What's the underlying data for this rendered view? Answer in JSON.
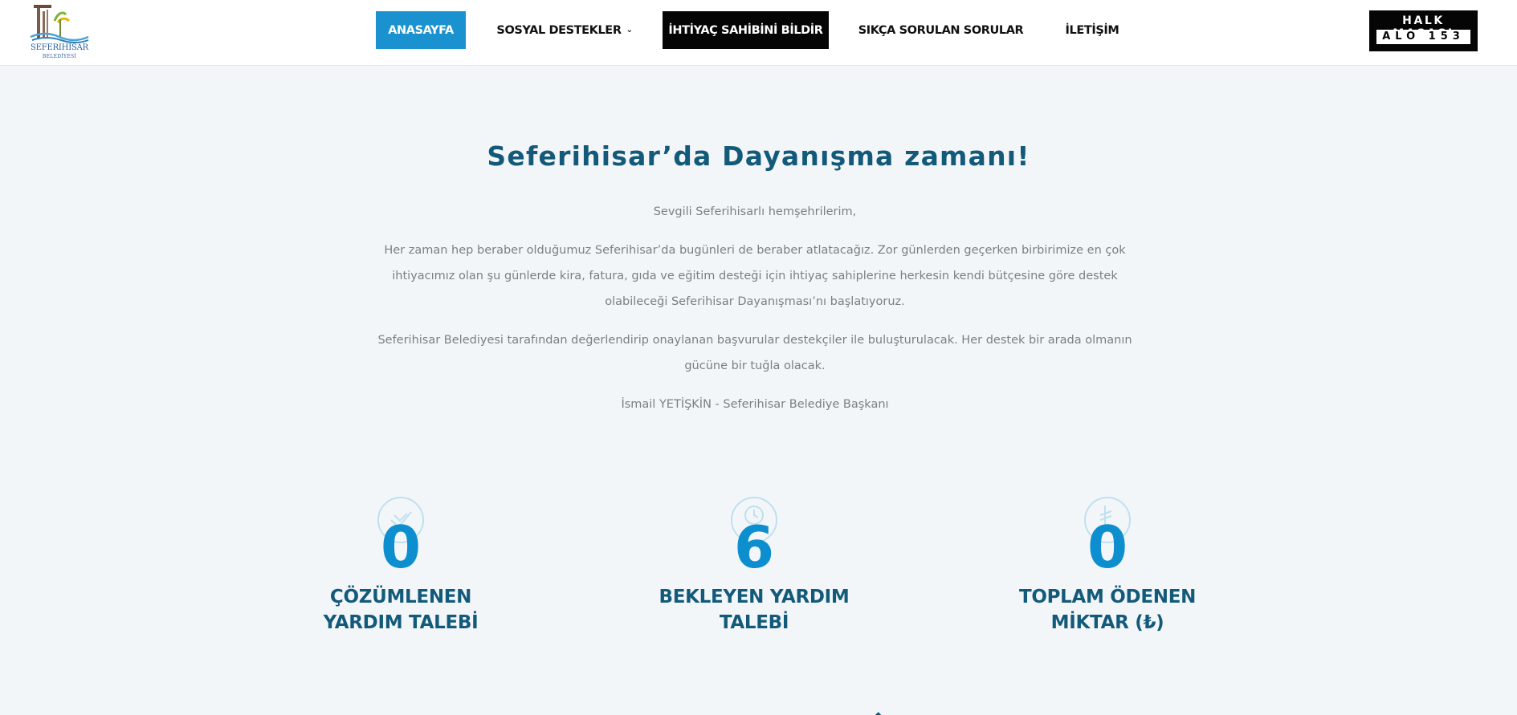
{
  "header": {
    "logo": {
      "name": "SEFERIHISAR",
      "sub": "BELEDİYESİ"
    },
    "nav": {
      "home": "ANASAYFA",
      "social": "SOSYAL DESTEKLER",
      "report": "İHTİYAÇ SAHİBİNİ BİLDİR",
      "faq": "SIKÇA SORULAN SORULAR",
      "contact": "İLETİŞİM"
    },
    "halk_masasi": {
      "top": "HALK MASASI",
      "bottom": "ALO 153"
    },
    "icons": {
      "chevron": "chevron-down-icon"
    }
  },
  "main": {
    "title": "Seferihisar’da Dayanışma zamanı!",
    "greeting": "Sevgili Seferihisarlı hemşehrilerim,",
    "paragraph1": "Her zaman hep beraber olduğumuz Seferihisar’da bugünleri de beraber atlatacağız. Zor günlerden geçerken birbirimize en çok ihtiyacımız olan şu günlerde kira, fatura, gıda ve eğitim desteği için ihtiyaç sahiplerine herkesin kendi bütçesine göre destek olabileceği Seferihisar Dayanışması’nı başlatıyoruz.",
    "paragraph2": "Seferihisar Belediyesi tarafından değerlendirip onaylanan başvurular destekçiler ile buluşturulacak. Her destek bir arada olmanın gücüne bir tuğla olacak.",
    "signature": "İsmail YETİŞKİN - Seferihisar Belediye Başkanı"
  },
  "stats": [
    {
      "icon": "check-circle-icon",
      "value": "0",
      "label_line1": "ÇÖZÜMLENEN",
      "label_line2": "YARDIM TALEBİ"
    },
    {
      "icon": "clock-circle-icon",
      "value": "6",
      "label_line1": "BEKLEYEN YARDIM",
      "label_line2": "TALEBİ"
    },
    {
      "icon": "lira-circle-icon",
      "value": "0",
      "label_line1": "TOPLAM ÖDENEN",
      "label_line2": "MİKTAR (₺)"
    }
  ],
  "colors": {
    "accent_blue": "#1992cf",
    "heading_navy": "#135a7a",
    "body_text": "#7b7f83",
    "background": "#f3f6f9"
  }
}
